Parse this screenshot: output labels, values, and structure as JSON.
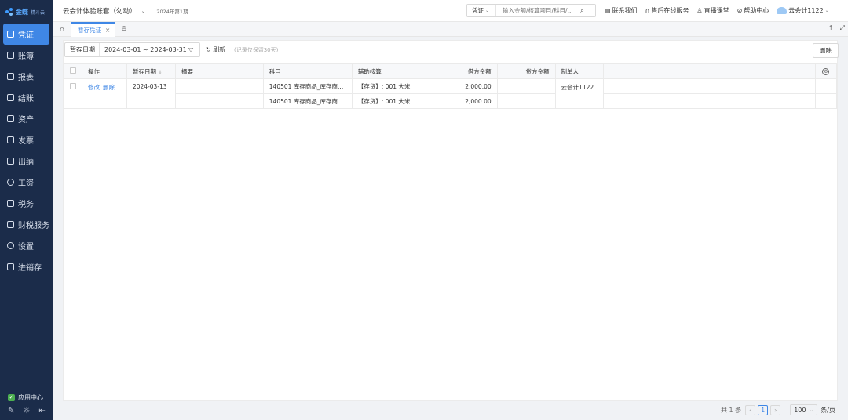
{
  "sidebar": {
    "logo_text": "金蝶",
    "logo_sub": "精斗云",
    "items": [
      {
        "label": "凭证",
        "icon": "voucher-icon",
        "active": true
      },
      {
        "label": "账簿",
        "icon": "ledger-icon"
      },
      {
        "label": "报表",
        "icon": "report-icon"
      },
      {
        "label": "结账",
        "icon": "closing-icon"
      },
      {
        "label": "资产",
        "icon": "asset-icon"
      },
      {
        "label": "发票",
        "icon": "invoice-icon"
      },
      {
        "label": "出纳",
        "icon": "cashier-icon"
      },
      {
        "label": "工资",
        "icon": "salary-icon"
      },
      {
        "label": "税务",
        "icon": "tax-icon"
      },
      {
        "label": "财税服务",
        "icon": "finance-service-icon"
      },
      {
        "label": "设置",
        "icon": "settings-icon"
      },
      {
        "label": "进销存",
        "icon": "inventory-icon"
      }
    ],
    "app_center": "应用中心"
  },
  "topbar": {
    "account": "云会计体验账套（勿动）",
    "period": "2024年第1期",
    "search_type": "凭证",
    "search_placeholder": "输入金额/核算项目/科目/...",
    "links": [
      "联系我们",
      "售后在线服务",
      "直播课堂",
      "帮助中心"
    ],
    "user": "云会计1122"
  },
  "tabs": {
    "active": "暂存凭证"
  },
  "toolbar": {
    "date_label": "暂存日期",
    "date_range": "2024-03-01 ~ 2024-03-31",
    "refresh": "刷新",
    "hint": "(记录仅保留30天)",
    "delete": "删除"
  },
  "table": {
    "headers": [
      "操作",
      "暂存日期",
      "摘要",
      "科目",
      "辅助核算",
      "借方金额",
      "贷方金额",
      "制单人"
    ],
    "actions": [
      "修改",
      "删除"
    ],
    "date": "2024-03-13",
    "summary": "",
    "maker": "云会计1122",
    "entries": [
      {
        "account": "140501 库存商品_库存商...",
        "aux": "【存货】: 001 大米",
        "debit": "2,000.00",
        "credit": ""
      },
      {
        "account": "140501 库存商品_库存商...",
        "aux": "【存货】: 001 大米",
        "debit": "2,000.00",
        "credit": ""
      }
    ]
  },
  "pagination": {
    "total": "共 1 条",
    "current": "1",
    "page_size": "100",
    "unit": "条/页"
  },
  "colors": {
    "sidebar_bg": "#1b2c4a",
    "accent": "#3f87e6"
  }
}
